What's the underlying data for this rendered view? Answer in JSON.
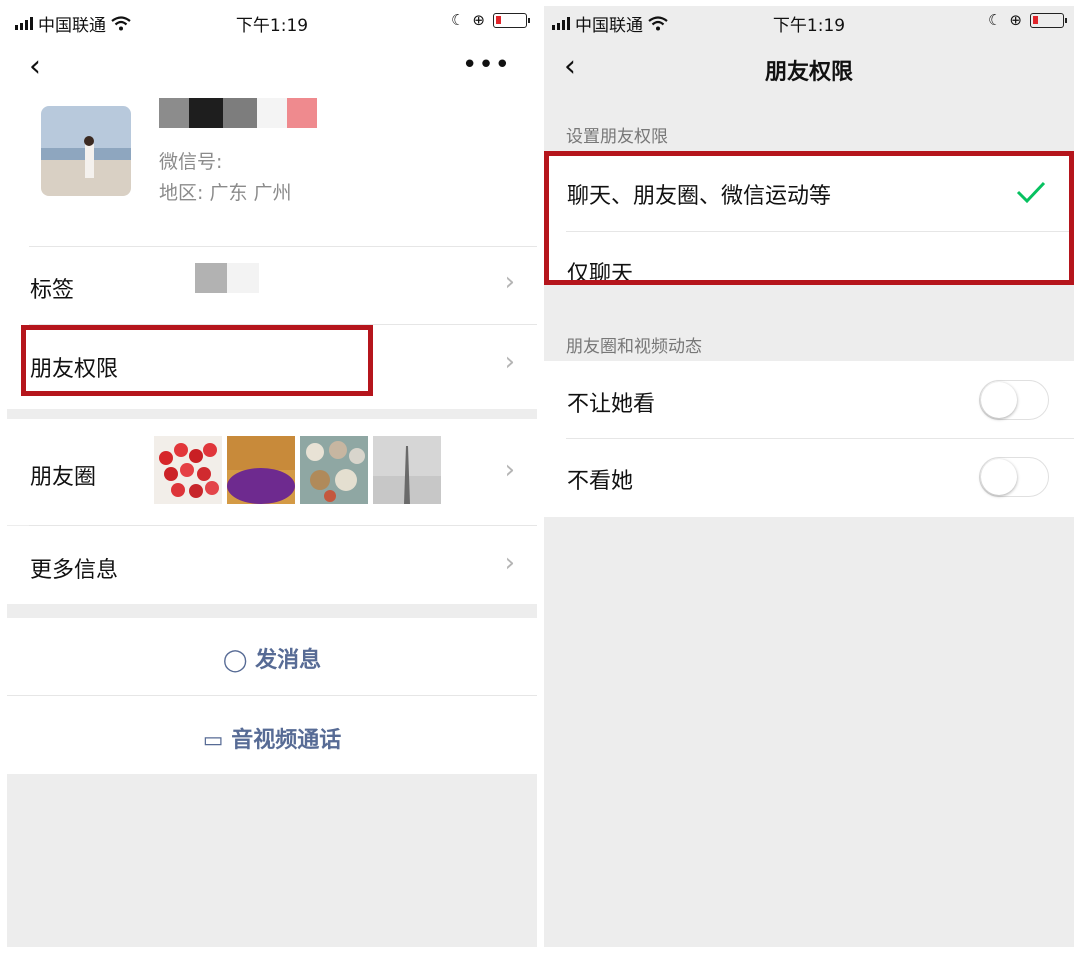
{
  "statusbar": {
    "carrier": "中国联通",
    "time": "下午1:19"
  },
  "profile": {
    "wechat_id_label": "微信号:",
    "region": "地区:  广东  广州"
  },
  "left_menu": {
    "tags_label": "标签",
    "permissions_label": "朋友权限",
    "moments_label": "朋友圈",
    "more_info_label": "更多信息",
    "send_message": "发消息",
    "video_call": "音视频通话"
  },
  "right_screen": {
    "title": "朋友权限",
    "section_permissions": "设置朋友权限",
    "option_all": "聊天、朋友圈、微信运动等",
    "option_chat_only": "仅聊天",
    "section_moments": "朋友圈和视频动态",
    "hide_my_posts": "不让她看",
    "hide_her_posts": "不看她"
  },
  "colors": {
    "highlight": "#b5151c",
    "check": "#07c160",
    "link": "#576b95"
  }
}
